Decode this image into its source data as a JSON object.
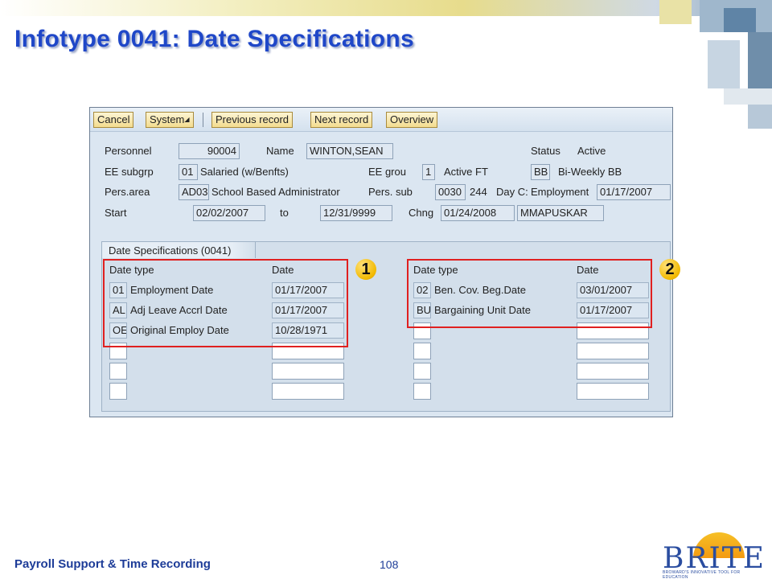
{
  "slide": {
    "title": "Infotype 0041: Date Specifications",
    "footer_left": "Payroll Support & Time Recording",
    "page_number": "108"
  },
  "toolbar": {
    "cancel": "Cancel",
    "system": "System",
    "previous": "Previous record",
    "next": "Next record",
    "overview": "Overview"
  },
  "header": {
    "personnel_label": "Personnel",
    "personnel_value": "90004",
    "name_label": "Name",
    "name_value": "WINTON,SEAN",
    "status_label": "Status",
    "status_value": "Active",
    "ee_subgrp_label": "EE subgrp",
    "ee_subgrp_code": "01",
    "ee_subgrp_text": "Salaried (w/Benfts)",
    "ee_group_label": "EE grou",
    "ee_group_code": "1",
    "ee_group_text": "Active FT",
    "payroll_code": "BB",
    "payroll_text": "Bi-Weekly BB",
    "pers_area_label": "Pers.area",
    "pers_area_code": "AD03",
    "pers_area_text": "School Based Administrator",
    "pers_sub_label": "Pers. sub",
    "pers_sub_code": "0030",
    "pers_sub_num": "244",
    "pers_sub_text": "Day C:",
    "employment_label": "Employment",
    "employment_value": "01/17/2007",
    "start_label": "Start",
    "start_value": "02/02/2007",
    "to_label": "to",
    "to_value": "12/31/9999",
    "chng_label": "Chng",
    "chng_value": "01/24/2008",
    "chng_user": "MMAPUSKAR"
  },
  "date_specs": {
    "group_title": "Date Specifications (0041)",
    "col_date_type": "Date type",
    "col_date": "Date",
    "left_rows": [
      {
        "code": "01",
        "text": "Employment Date",
        "date": "01/17/2007"
      },
      {
        "code": "AL",
        "text": "Adj Leave Accrl Date",
        "date": "01/17/2007"
      },
      {
        "code": "OE",
        "text": "Original Employ Date",
        "date": "10/28/1971"
      }
    ],
    "right_rows": [
      {
        "code": "02",
        "text": "Ben. Cov. Beg.Date",
        "date": "03/01/2007"
      },
      {
        "code": "BU",
        "text": "Bargaining Unit Date",
        "date": "01/17/2007"
      }
    ]
  },
  "callouts": {
    "one": "1",
    "two": "2"
  },
  "logo": {
    "text": "BRITE",
    "tagline": "BROWARD'S INNOVATIVE TOOL FOR EDUCATION"
  },
  "colors": {
    "title": "#1f47c8",
    "highlight": "#e02020",
    "badge": "#f2b900"
  }
}
